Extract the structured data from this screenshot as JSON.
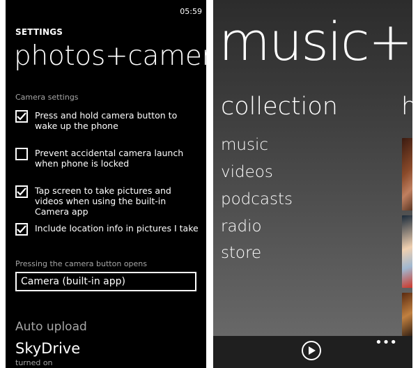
{
  "settings_screen": {
    "status_time": "05:59",
    "header_label": "SETTINGS",
    "title": "photos+camera",
    "camera_settings_label": "Camera settings",
    "options": [
      {
        "label": "Press and hold camera button to wake up the phone",
        "checked": true
      },
      {
        "label": "Prevent accidental camera launch when phone is locked",
        "checked": false
      },
      {
        "label": "Tap screen to take pictures and videos when using the built-in Camera app",
        "checked": true
      },
      {
        "label": "Include location info in pictures I take",
        "checked": true
      }
    ],
    "camera_button_label": "Pressing the camera button opens",
    "camera_button_value": "Camera (built-in app)",
    "auto_upload_label": "Auto upload",
    "auto_upload_service": "SkyDrive",
    "auto_upload_status": "turned on"
  },
  "music_screen": {
    "hub_title": "music+videos",
    "section_title": "collection",
    "next_section_peek": "history",
    "items": [
      "music",
      "videos",
      "podcasts",
      "radio",
      "store"
    ],
    "icons": {
      "play": "play-icon",
      "more": "more-icon"
    },
    "more_label": "•••",
    "colors": {
      "appbar": "#1f1f1f",
      "background_top": "#2c2c2c",
      "background_bottom": "#6e6e6e"
    }
  }
}
